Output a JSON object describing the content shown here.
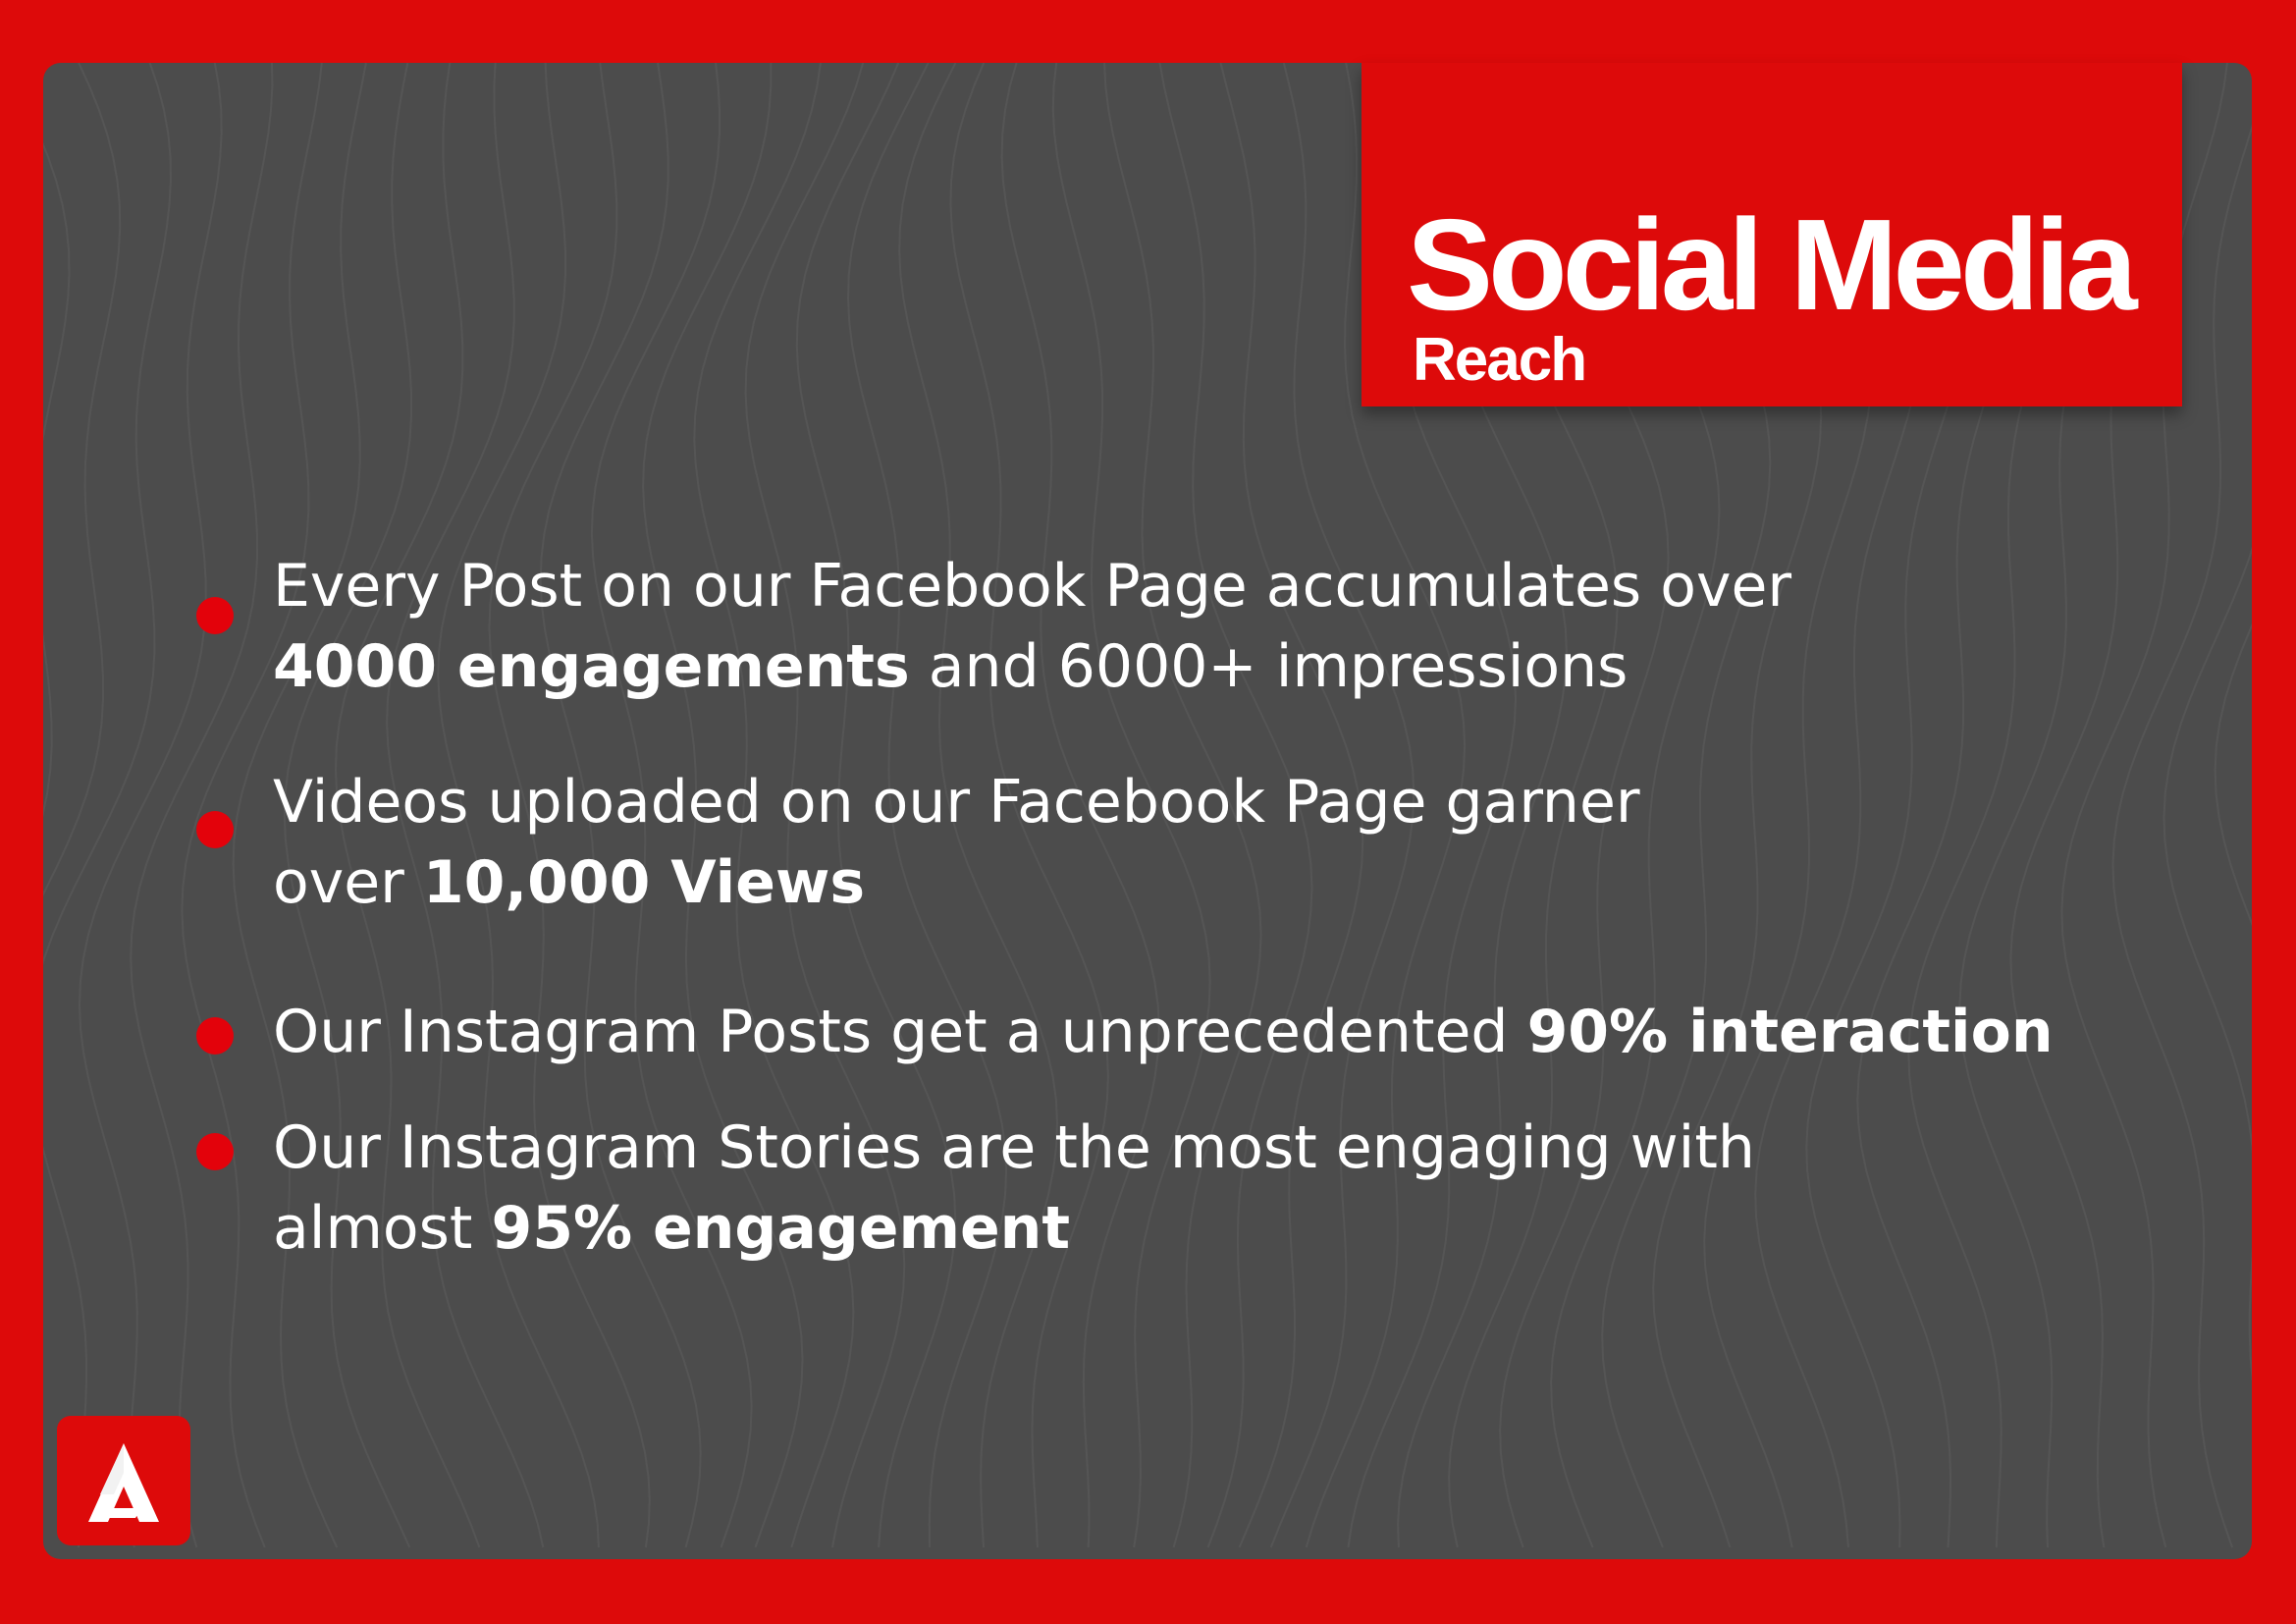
{
  "title": {
    "main": "Social Media",
    "sub": "Reach"
  },
  "bullets": [
    {
      "line1": "Every Post on our Facebook Page accumulates over",
      "line2_bold": "4000 engagements",
      "line2_rest": " and 6000+ impressions"
    },
    {
      "line1": "Videos uploaded on our Facebook Page garner",
      "line2_pre": "over ",
      "line2_bold": "10,000 Views"
    },
    {
      "line1_pre": "Our Instagram Posts get a unprecedented ",
      "line1_bold": "90% interaction"
    },
    {
      "line1": "Our Instagram Stories are the most engaging with",
      "line2_pre": "almost ",
      "line2_bold": "95% engagement"
    }
  ],
  "colors": {
    "accent": "#dd0a0a",
    "panel": "#4c4c4c",
    "text": "#ffffff"
  },
  "logo_icon": "a-letter-logo-icon"
}
